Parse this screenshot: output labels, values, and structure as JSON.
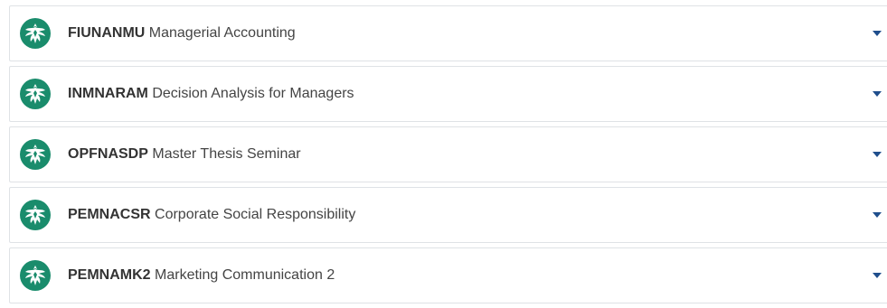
{
  "colors": {
    "logo_green": "#1a8c6c",
    "caret_blue": "#1f4e8c",
    "border": "#dfe2e6"
  },
  "courses": [
    {
      "code": "FIUNANMU",
      "name": "Managerial Accounting",
      "icon": "eagle-crest-icon",
      "toggle_icon": "caret-down-icon"
    },
    {
      "code": "INMNARAM",
      "name": "Decision Analysis for Managers",
      "icon": "eagle-crest-icon",
      "toggle_icon": "caret-down-icon"
    },
    {
      "code": "OPFNASDP",
      "name": "Master Thesis Seminar",
      "icon": "eagle-crest-icon",
      "toggle_icon": "caret-down-icon"
    },
    {
      "code": "PEMNACSR",
      "name": "Corporate Social Responsibility",
      "icon": "eagle-crest-icon",
      "toggle_icon": "caret-down-icon"
    },
    {
      "code": "PEMNAMK2",
      "name": "Marketing Communication 2",
      "icon": "eagle-crest-icon",
      "toggle_icon": "caret-down-icon"
    }
  ]
}
